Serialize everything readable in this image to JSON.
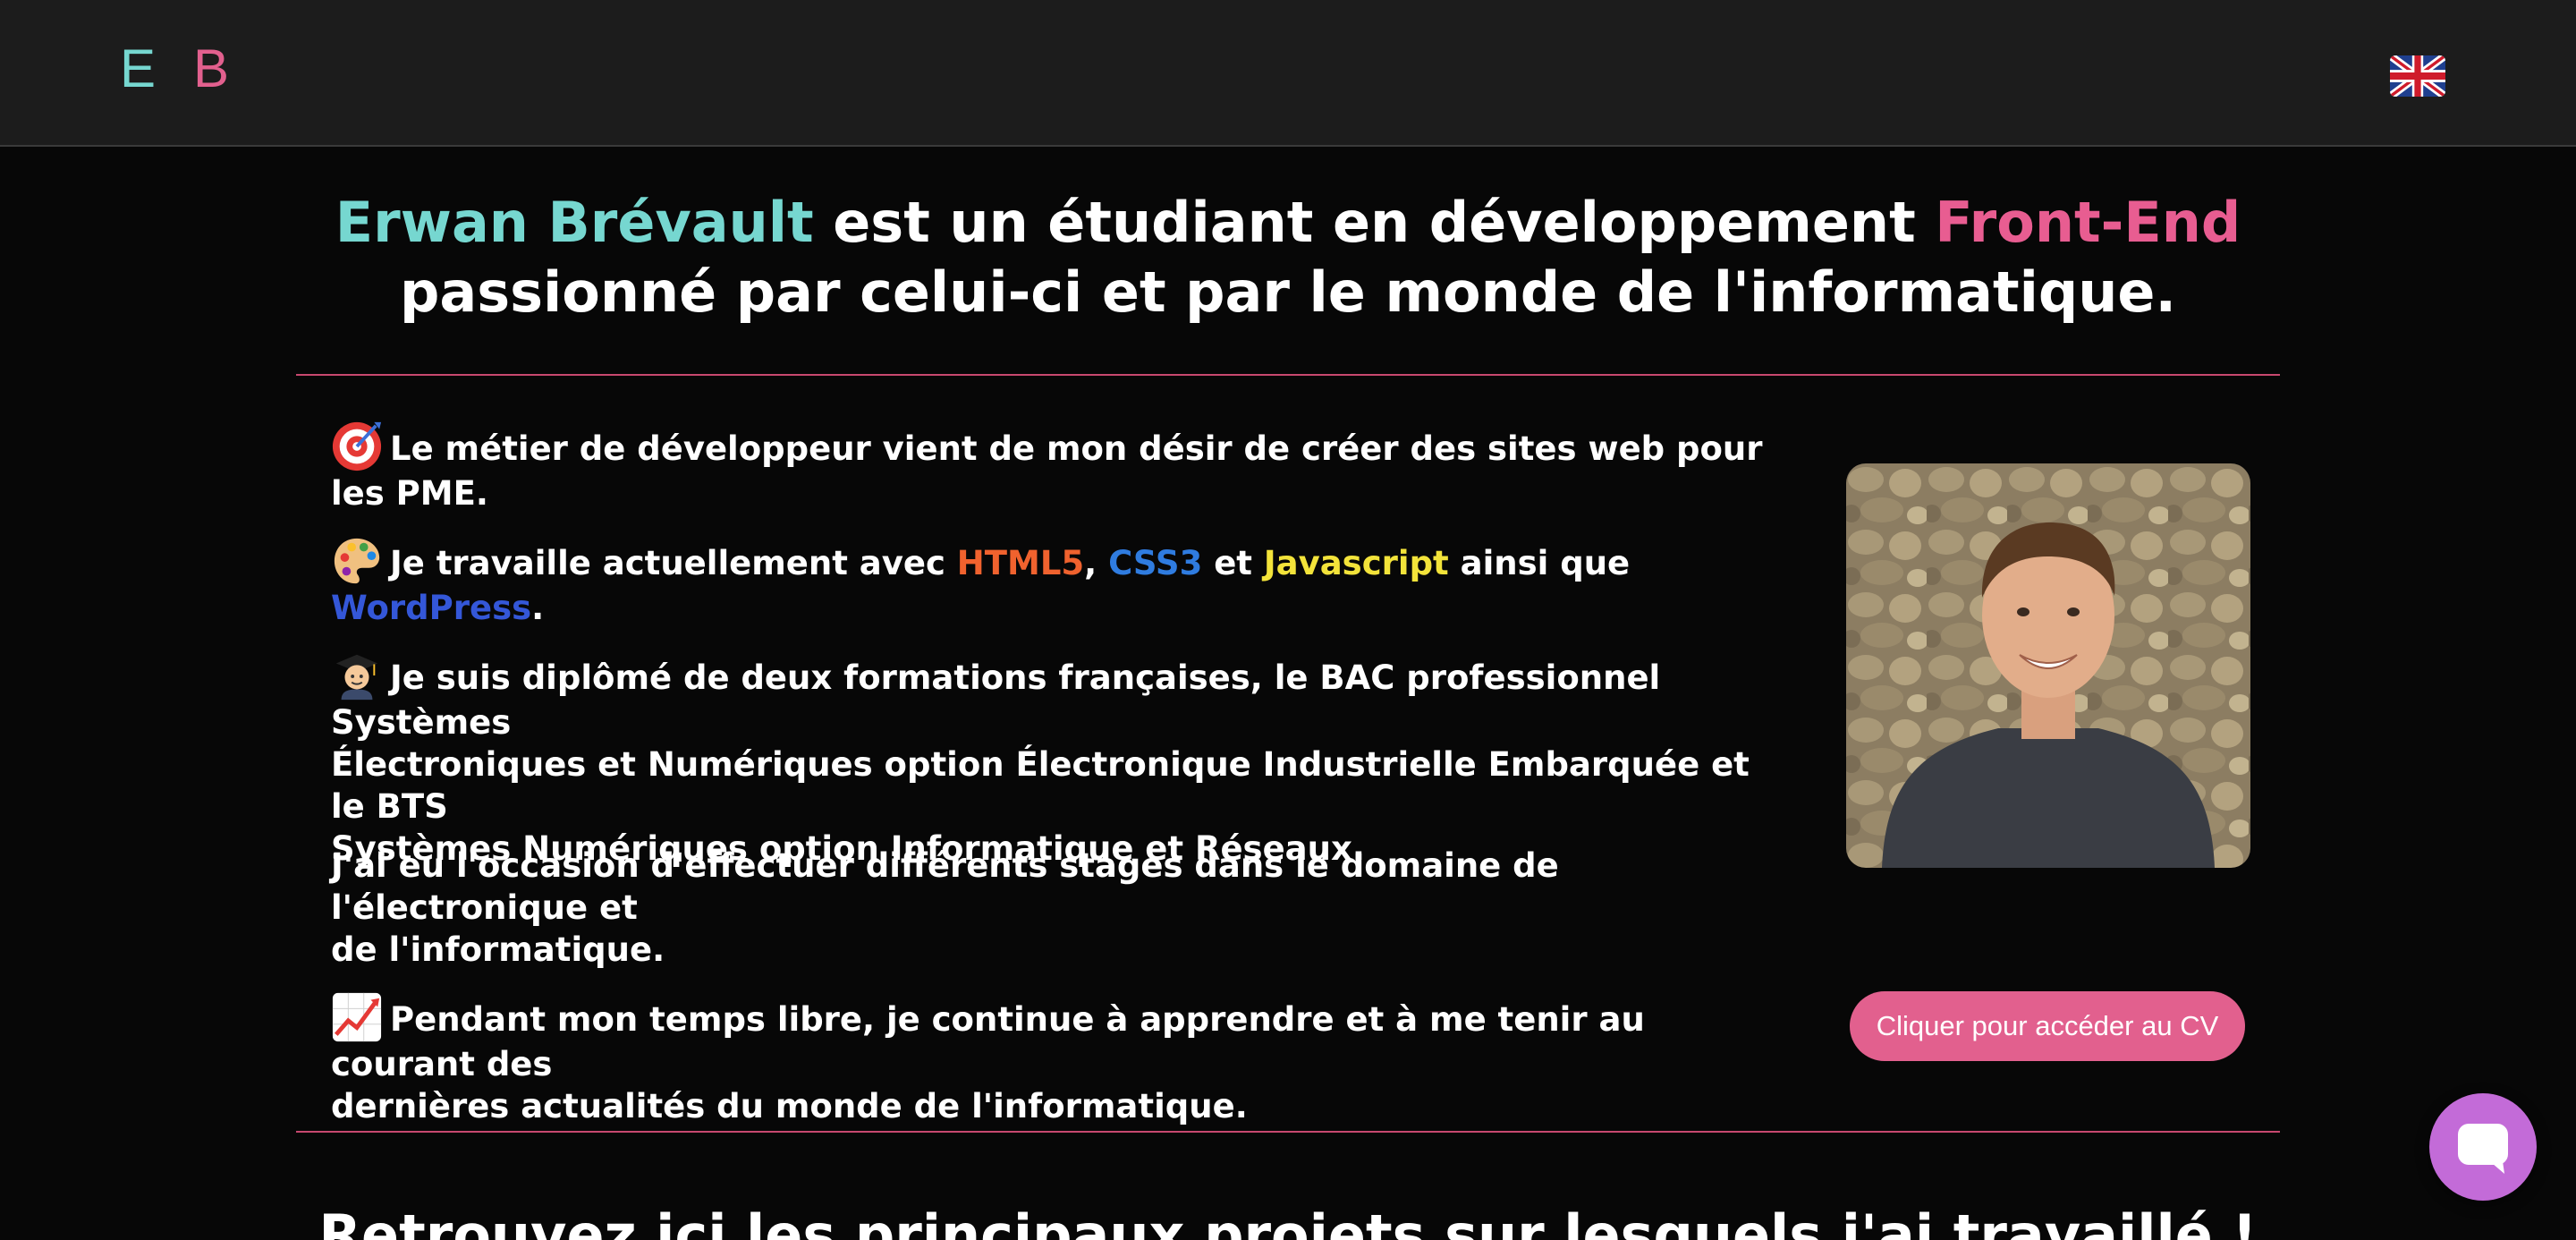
{
  "header": {
    "logo_e": "E",
    "logo_b": "B",
    "language_icon": "uk-flag-icon"
  },
  "intro": {
    "name": "Erwan Brévault",
    "text1": " est un étudiant en développement ",
    "highlight": "Front-End",
    "text2": "passionné par celui-ci et par le monde de l'informatique."
  },
  "about": {
    "p1": {
      "icon": "target-emoji",
      "text": "Le métier de développeur vient de mon désir de créer des sites web pour les PME."
    },
    "p2": {
      "icon": "palette-emoji",
      "prefix": "Je travaille actuellement avec ",
      "tech1": "HTML5",
      "sep1": ", ",
      "tech2": "CSS3",
      "sep2": " et ",
      "tech3": "Javascript",
      "sep3": " ainsi que ",
      "tech4": "WordPress",
      "suffix": "."
    },
    "p3": {
      "icon": "graduate-emoji",
      "line1": "Je suis diplômé de deux formations françaises, le BAC professionnel Systèmes",
      "line2": "Électroniques et Numériques option Électronique Industrielle Embarquée et le BTS",
      "line3": "Systèmes Numériques option Informatique et Réseaux."
    },
    "p4": {
      "line1": "J'ai eu l'occasion d'effectuer différents stages dans le domaine de l'électronique et",
      "line2": "de l'informatique."
    },
    "p5": {
      "icon": "chart-increasing-emoji",
      "line1": "Pendant mon temps libre, je continue à apprendre et à me tenir au courant des",
      "line2": "dernières actualités du monde de l'informatique."
    }
  },
  "cv_button": "Cliquer pour accéder au CV",
  "projects_heading": "Retrouvez ici les principaux projets sur lesquels j'ai travaillé !",
  "chat": {
    "icon": "chat-bubble-icon"
  },
  "colors": {
    "accent_teal": "#76d7d0",
    "accent_pink": "#e2608e",
    "html5": "#f0622e",
    "css3": "#2f7ce0",
    "javascript": "#f3e33a",
    "wordpress": "#3457d8",
    "background": "#070707",
    "header_bg": "#1c1c1c",
    "chat_button": "#c36bd8"
  }
}
